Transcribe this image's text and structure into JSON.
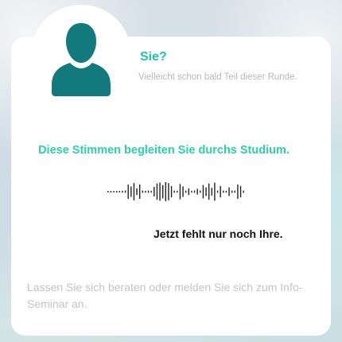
{
  "profile": {
    "icon": "person-icon",
    "title": "Sie?",
    "subtitle": "Vielleicht schon bald Teil dieser Runde."
  },
  "headline": "Diese Stimmen begleiten Sie durchs Studium.",
  "waveform": {
    "icon": "audio-waveform-icon",
    "levels": [
      0.08,
      0.08,
      0.08,
      0.08,
      0.08,
      0.1,
      0.12,
      0.75,
      0.55,
      0.9,
      0.35,
      0.75,
      0.12,
      0.1,
      0.12,
      0.1,
      0.5,
      0.85,
      0.95,
      0.7,
      1.0,
      0.9,
      0.6,
      0.12,
      0.1,
      0.8,
      0.55,
      0.12,
      0.35,
      0.1,
      0.12,
      0.3,
      0.12,
      0.7,
      0.45,
      0.85,
      0.4,
      0.95,
      0.12,
      0.6,
      0.12,
      0.1,
      0.45,
      0.12,
      0.12,
      0.75,
      0.6,
      0.12
    ],
    "color": "#222222"
  },
  "missing_text": "Jetzt fehlt nur noch Ihre.",
  "cta_text": "Lassen Sie sich beraten oder melden Sie sich zum Info-Seminar an.",
  "colors": {
    "accent": "#1cc7a6",
    "icon_teal": "#127a7d",
    "card": "#ffffff",
    "muted_text": "#c3c3c3"
  }
}
